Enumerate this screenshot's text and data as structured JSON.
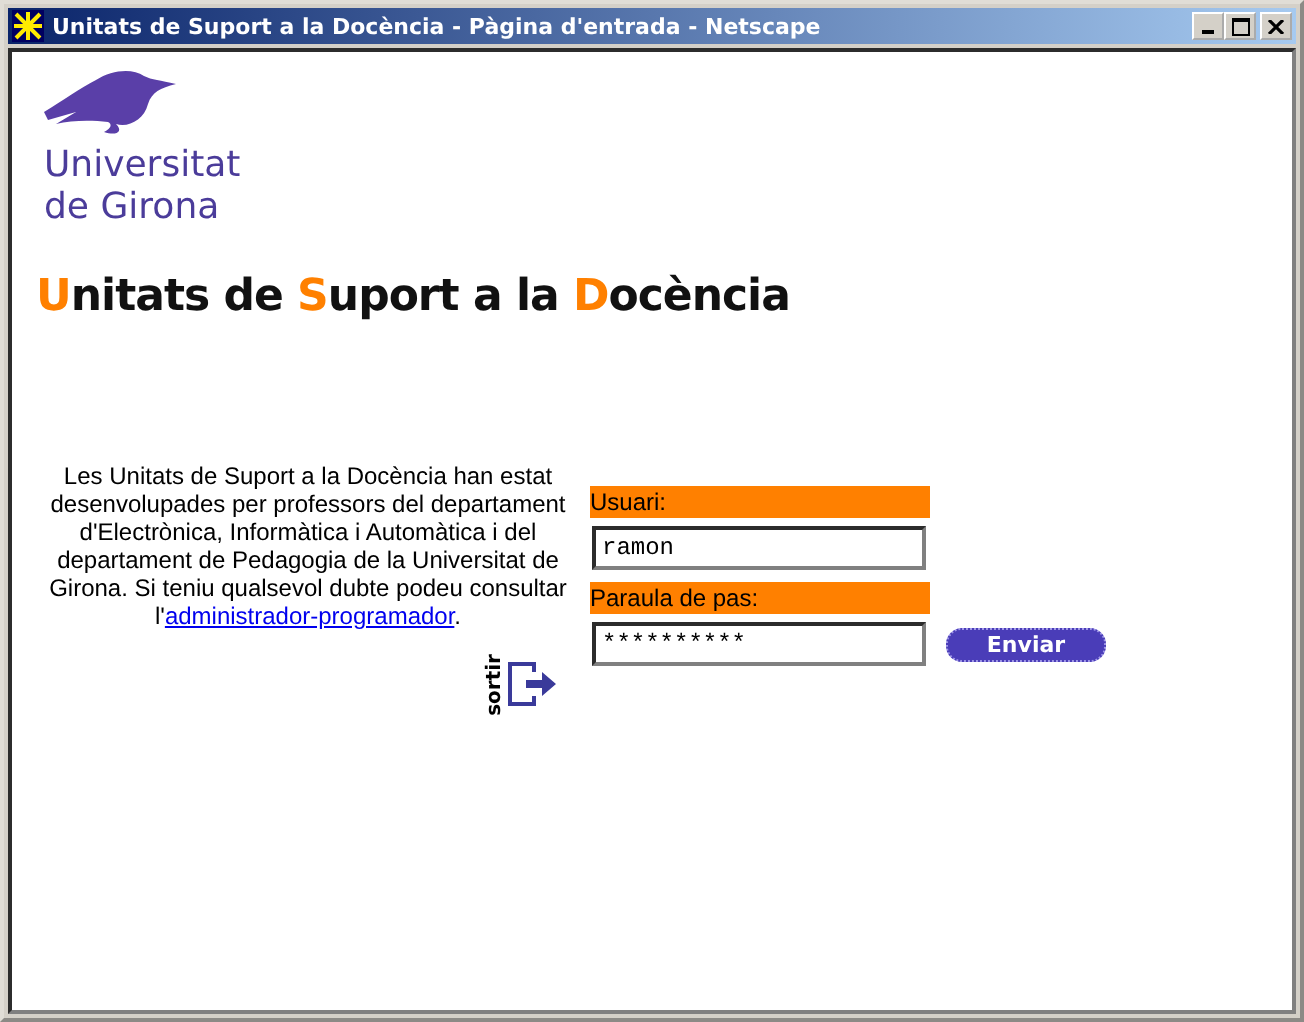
{
  "window": {
    "title": "Unitats de Suport a la Docència - Pàgina d'entrada - Netscape"
  },
  "logo": {
    "line1": "Universitat",
    "line2": "de Girona"
  },
  "heading": [
    {
      "text": "U",
      "highlight": true
    },
    {
      "text": "nitats de ",
      "highlight": false
    },
    {
      "text": "S",
      "highlight": true
    },
    {
      "text": "uport a la ",
      "highlight": false
    },
    {
      "text": "D",
      "highlight": true
    },
    {
      "text": "ocència",
      "highlight": false
    }
  ],
  "intro": {
    "before": "Les Unitats de Suport a la Docència han estat desenvolupades per professors del departament d'Electrònica, Informàtica i Automàtica i del departament de Pedagogia de la Universitat de Girona. Si teniu qualsevol dubte podeu consultar l'",
    "link": "administrador-programador",
    "after": "."
  },
  "exit": {
    "label": "sortir"
  },
  "form": {
    "user_label": "Usuari:",
    "user_value": "ramon",
    "password_label": "Paraula de pas:",
    "password_value": "**********",
    "submit": "Enviar"
  }
}
